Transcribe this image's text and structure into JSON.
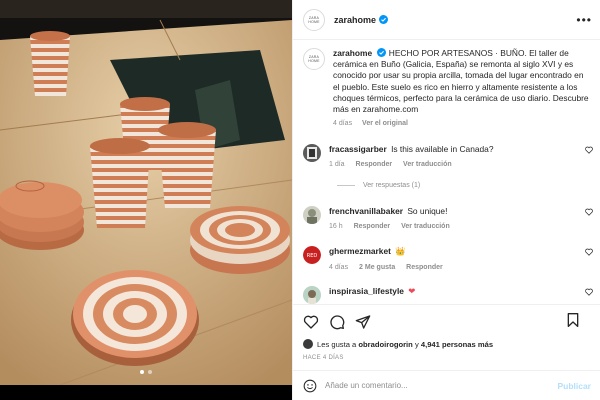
{
  "post": {
    "account": "zarahome",
    "logo_text": "ZARA HOME",
    "caption_prefix": "HECHO POR ARTESANOS · BUÑO.",
    "caption_text": "El taller de cerámica en Buño (Galicia, España) se remonta al siglo XVI y es conocido por usar su propia arcilla, tomada del lugar encontrado en el pueblo. Este suelo es rico en hierro y altamente resistente a los choques térmicos, perfecto para la cerámica de uso diario. Descubre más en zarahome.com",
    "caption_age": "4 días",
    "see_translation": "Ver el original",
    "media_slides": 2,
    "active_slide": 1
  },
  "comments": [
    {
      "user": "fracassigarber",
      "text": "Is this available in Canada?",
      "age": "1 día",
      "reply": "Responder",
      "translate": "Ver traducción",
      "avatar_color": "#5b5b5b"
    },
    {
      "user": "frenchvanillabaker",
      "text": "So unique!",
      "age": "16 h",
      "reply": "Responder",
      "translate": "Ver traducción",
      "avatar_color": "#cfcfc4"
    },
    {
      "user": "ghermezmarket",
      "text": "👑",
      "age": "4 días",
      "likes": "2 Me gusta",
      "reply": "Responder",
      "avatar_color": "#c8201f",
      "avatar_label": "RED"
    },
    {
      "user": "inspirasia_lifestyle",
      "text": "❤",
      "avatar_color": "#b9d3c4"
    }
  ],
  "view_replies": "Ver respuestas (1)",
  "likes": {
    "prefix": "Les gusta a",
    "user": "obradoirogorin",
    "connector": "y",
    "count": "4,941 personas más"
  },
  "time_ago": "HACE 4 DÍAS",
  "add_comment": {
    "placeholder": "Añade un comentario...",
    "publish": "Publicar"
  },
  "icons": [
    "verified-icon",
    "more-icon",
    "heart-icon",
    "comment-icon",
    "share-icon",
    "save-icon",
    "emoji-icon"
  ],
  "colors": {
    "link": "#b2dffc",
    "muted": "#8e8e8e",
    "verified": "#0095f6",
    "clay": "#d9865a"
  }
}
